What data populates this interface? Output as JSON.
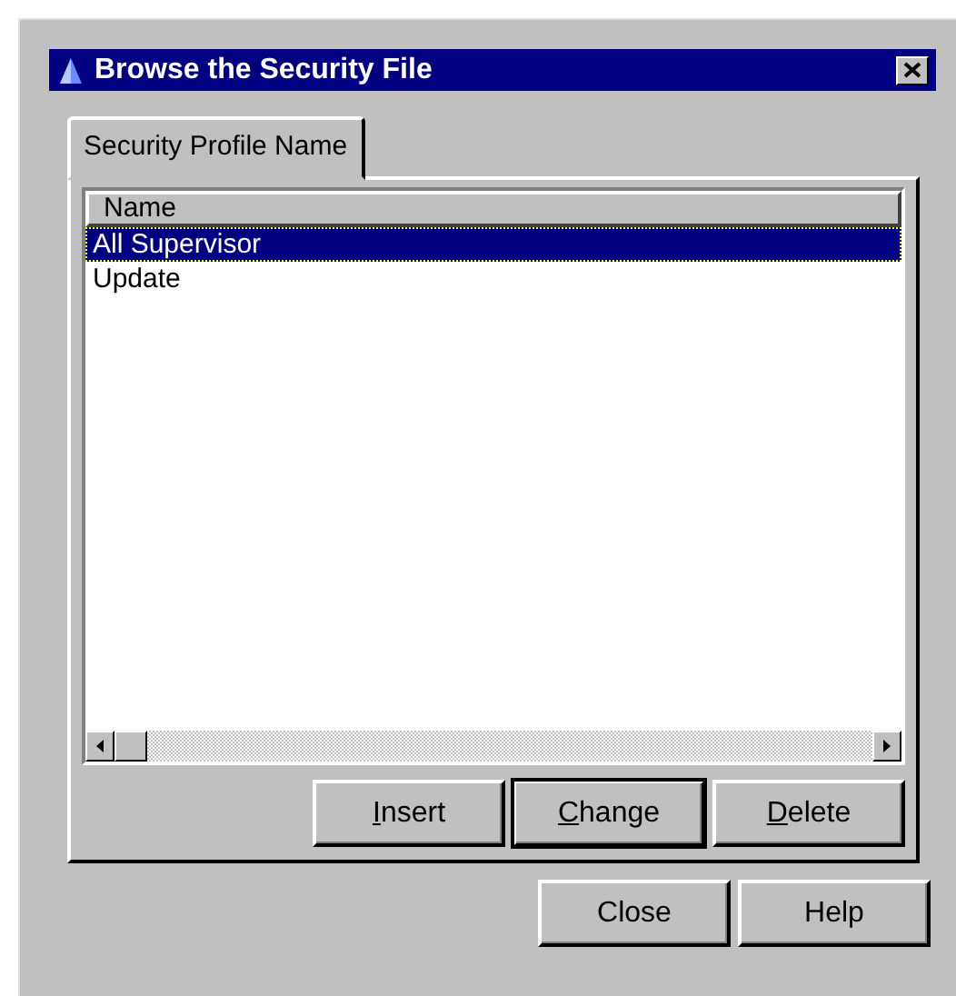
{
  "window": {
    "title": "Browse the Security File"
  },
  "tabs": [
    {
      "label": "Security Profile Name",
      "selected": true
    }
  ],
  "list": {
    "columns": [
      "Name"
    ],
    "rows": [
      {
        "name": "All Supervisor",
        "selected": true
      },
      {
        "name": "Update",
        "selected": false
      }
    ]
  },
  "panel_buttons": [
    {
      "label": "Insert",
      "underline_first": true,
      "default": false
    },
    {
      "label": "Change",
      "underline_first": true,
      "default": true
    },
    {
      "label": "Delete",
      "underline_first": true,
      "default": false
    }
  ],
  "dialog_buttons": [
    {
      "label": "Close",
      "underline_first": false,
      "default": false
    },
    {
      "label": "Help",
      "underline_first": false,
      "default": false
    }
  ]
}
